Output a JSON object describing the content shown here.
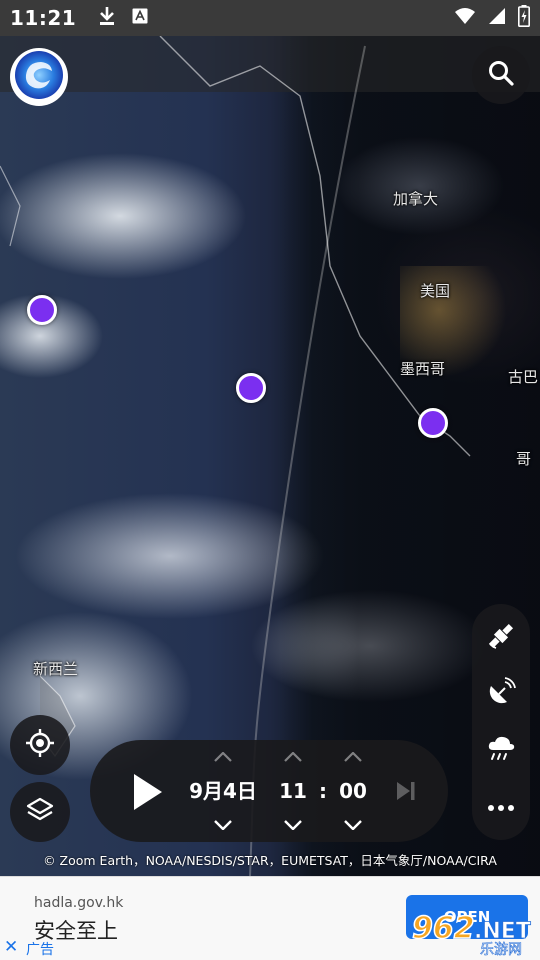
{
  "status_bar": {
    "time": "11:21",
    "icons": [
      "download-icon",
      "app-notification-icon",
      "wifi-icon",
      "signal-icon",
      "battery-charging-icon"
    ]
  },
  "map": {
    "labels": {
      "canada": "加拿大",
      "usa": "美国",
      "mexico": "墨西哥",
      "cuba": "古巴",
      "new_zealand": "新西兰",
      "partial_right": "哥"
    },
    "storm_markers": 3
  },
  "toolbar": {
    "logo_icon": "zoom-earth-logo-icon",
    "search_icon": "search-icon",
    "locate_icon": "crosshair-locate-icon",
    "layers_icon": "layers-icon"
  },
  "side_panel": {
    "icons": [
      "satellite-icon",
      "radar-icon",
      "rain-cloud-icon",
      "more-icon"
    ]
  },
  "timebar": {
    "date": "9月4日",
    "hour": "11",
    "separator": ":",
    "minute": "00"
  },
  "attribution": "© Zoom Earth，NOAA/NESDIS/STAR，EUMETSAT，日本气象厅/NOAA/CIRA",
  "ad": {
    "domain": "hadla.gov.hk",
    "title": "安全至上",
    "button_label": "OPEN",
    "close_label": "✕",
    "tag": "广告"
  },
  "watermark": {
    "number": "962",
    "suffix": ".NET",
    "text": "乐游网"
  },
  "colors": {
    "storm_marker": "#7b2ff0",
    "accent_blue": "#1a73e8",
    "panel_bg": "#19191c"
  }
}
